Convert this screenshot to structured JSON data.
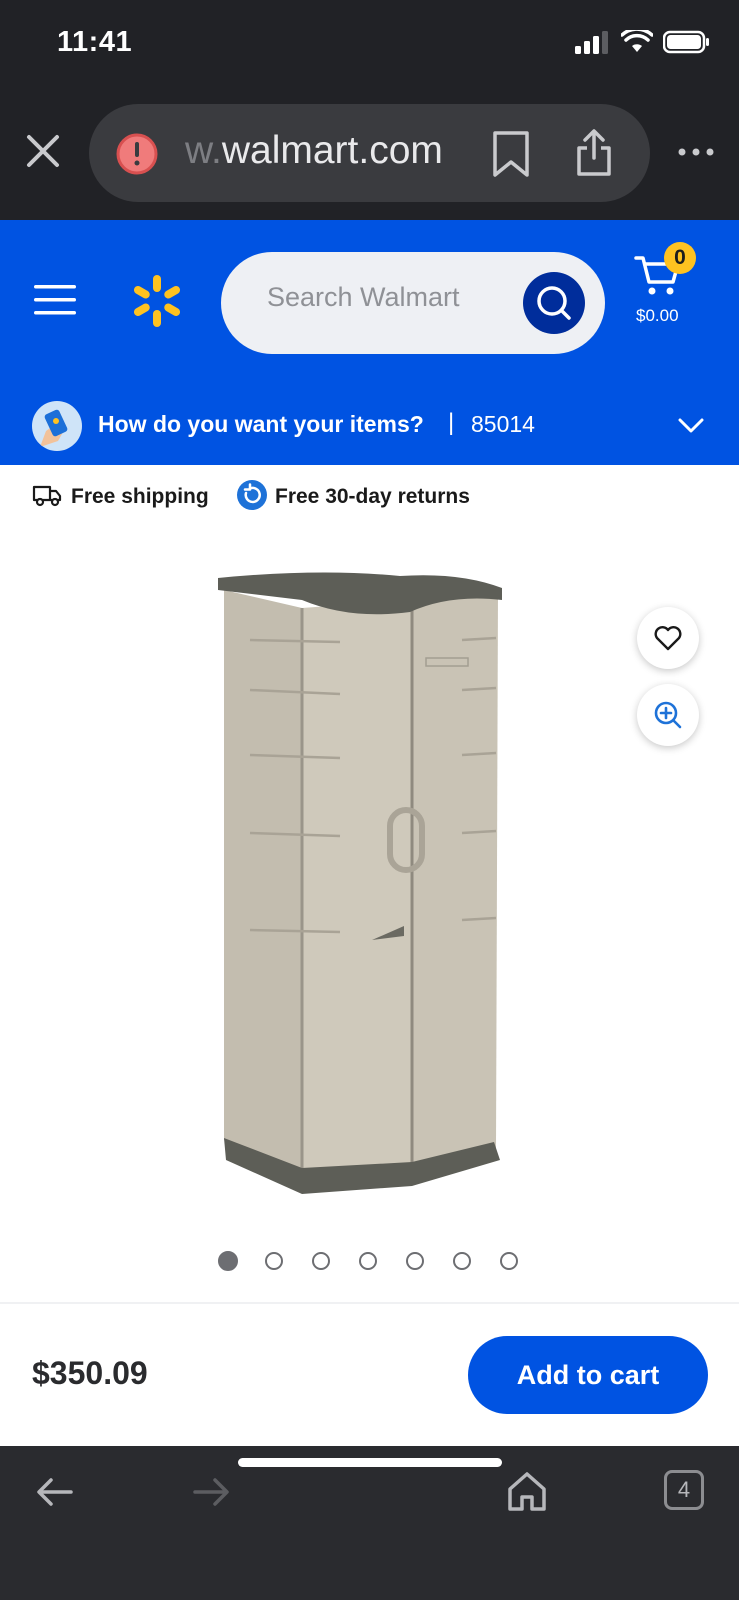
{
  "status_bar": {
    "time": "11:41"
  },
  "browser": {
    "url_prefix": "w.",
    "url_domain": "walmart.com"
  },
  "header": {
    "search_placeholder": "Search Walmart",
    "cart_count": "0",
    "cart_total": "$0.00"
  },
  "delivery": {
    "question": "How do you want your items?",
    "separator": "|",
    "zip": "85014"
  },
  "perks": {
    "shipping": "Free shipping",
    "returns": "Free 30-day returns"
  },
  "carousel": {
    "total": 7,
    "active_index": 0
  },
  "purchase": {
    "price": "$350.09",
    "add_to_cart_label": "Add to cart"
  },
  "toolbar": {
    "tab_count": "4"
  },
  "colors": {
    "brand_blue": "#0053e2",
    "brand_yellow": "#ffc220",
    "search_button": "#002d9b",
    "chrome_dark": "#212226"
  },
  "icons": [
    "close-icon",
    "alert-icon",
    "bookmark-icon",
    "share-icon",
    "more-icon",
    "menu-icon",
    "spark-logo",
    "search-icon",
    "cart-icon",
    "chevron-down-icon",
    "truck-icon",
    "returns-icon",
    "heart-icon",
    "zoom-in-icon",
    "back-arrow-icon",
    "forward-arrow-icon",
    "home-icon",
    "tabs-icon"
  ]
}
